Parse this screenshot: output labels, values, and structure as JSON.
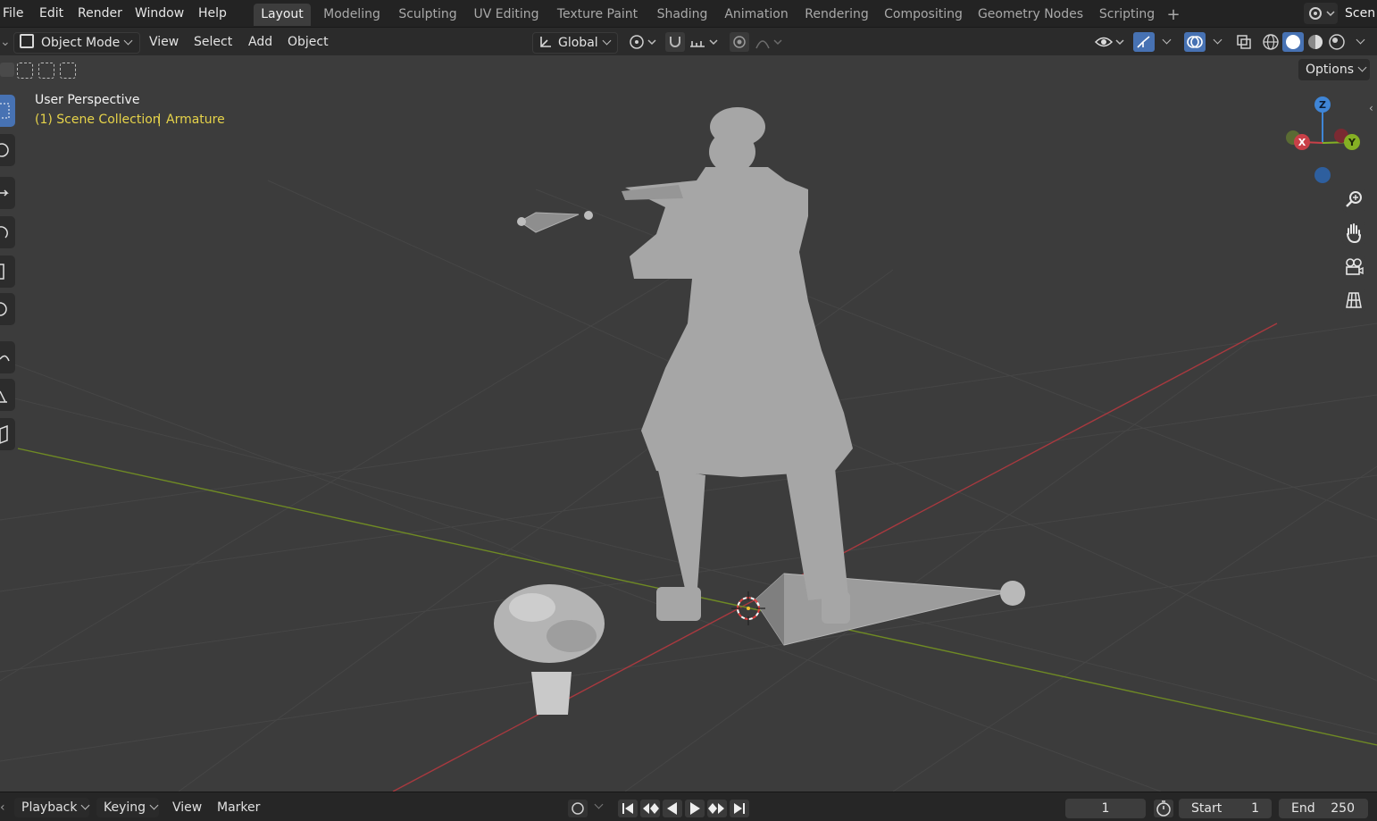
{
  "menubar": {
    "file": "File",
    "edit": "Edit",
    "render": "Render",
    "window": "Window",
    "help": "Help"
  },
  "workspaces": [
    "Layout",
    "Modeling",
    "Sculpting",
    "UV Editing",
    "Texture Paint",
    "Shading",
    "Animation",
    "Rendering",
    "Compositing",
    "Geometry Nodes",
    "Scripting"
  ],
  "scene_label": "Scen",
  "header": {
    "mode": "Object Mode",
    "view": "View",
    "select": "Select",
    "add": "Add",
    "object": "Object",
    "orientation": "Global",
    "options": "Options"
  },
  "viewport": {
    "perspective": "User Perspective",
    "collection": "(1) Scene Collection",
    "separator": "|",
    "active_object": "Armature"
  },
  "gizmo": {
    "x": "X",
    "y": "Y",
    "z": "Z"
  },
  "timeline": {
    "playback": "Playback",
    "keying": "Keying",
    "view": "View",
    "marker": "Marker",
    "current_frame": "1",
    "start_label": "Start",
    "start_value": "1",
    "end_label": "End",
    "end_value": "250"
  },
  "colors": {
    "accent": "#4772b3",
    "x_axis": "#c94048",
    "y_axis": "#85b024",
    "z_axis": "#3f85d6",
    "overlay_text": "#e6d34a"
  }
}
